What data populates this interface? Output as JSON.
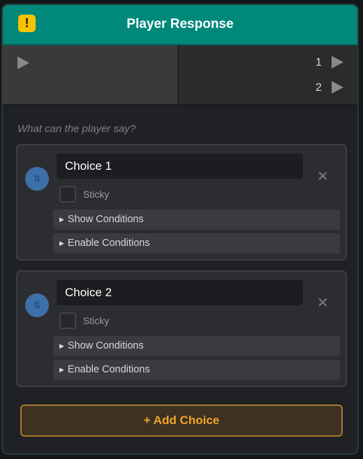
{
  "node": {
    "title": "Player Response",
    "warning_icon": "exclamation-icon",
    "warning_glyph": "!",
    "header_color": "#00897b"
  },
  "ports": {
    "outputs": [
      {
        "label": "1"
      },
      {
        "label": "2"
      }
    ]
  },
  "prompt": "What can the player say?",
  "choices": [
    {
      "text": "Choice 1",
      "sticky_label": "Sticky",
      "sticky_checked": false,
      "show_conditions_label": "Show Conditions",
      "enable_conditions_label": "Enable Conditions",
      "close_glyph": "✕"
    },
    {
      "text": "Choice 2",
      "sticky_label": "Sticky",
      "sticky_checked": false,
      "show_conditions_label": "Show Conditions",
      "enable_conditions_label": "Enable Conditions",
      "close_glyph": "✕"
    }
  ],
  "add_button": {
    "label": "+ Add Choice",
    "accent": "#f0a62a"
  }
}
